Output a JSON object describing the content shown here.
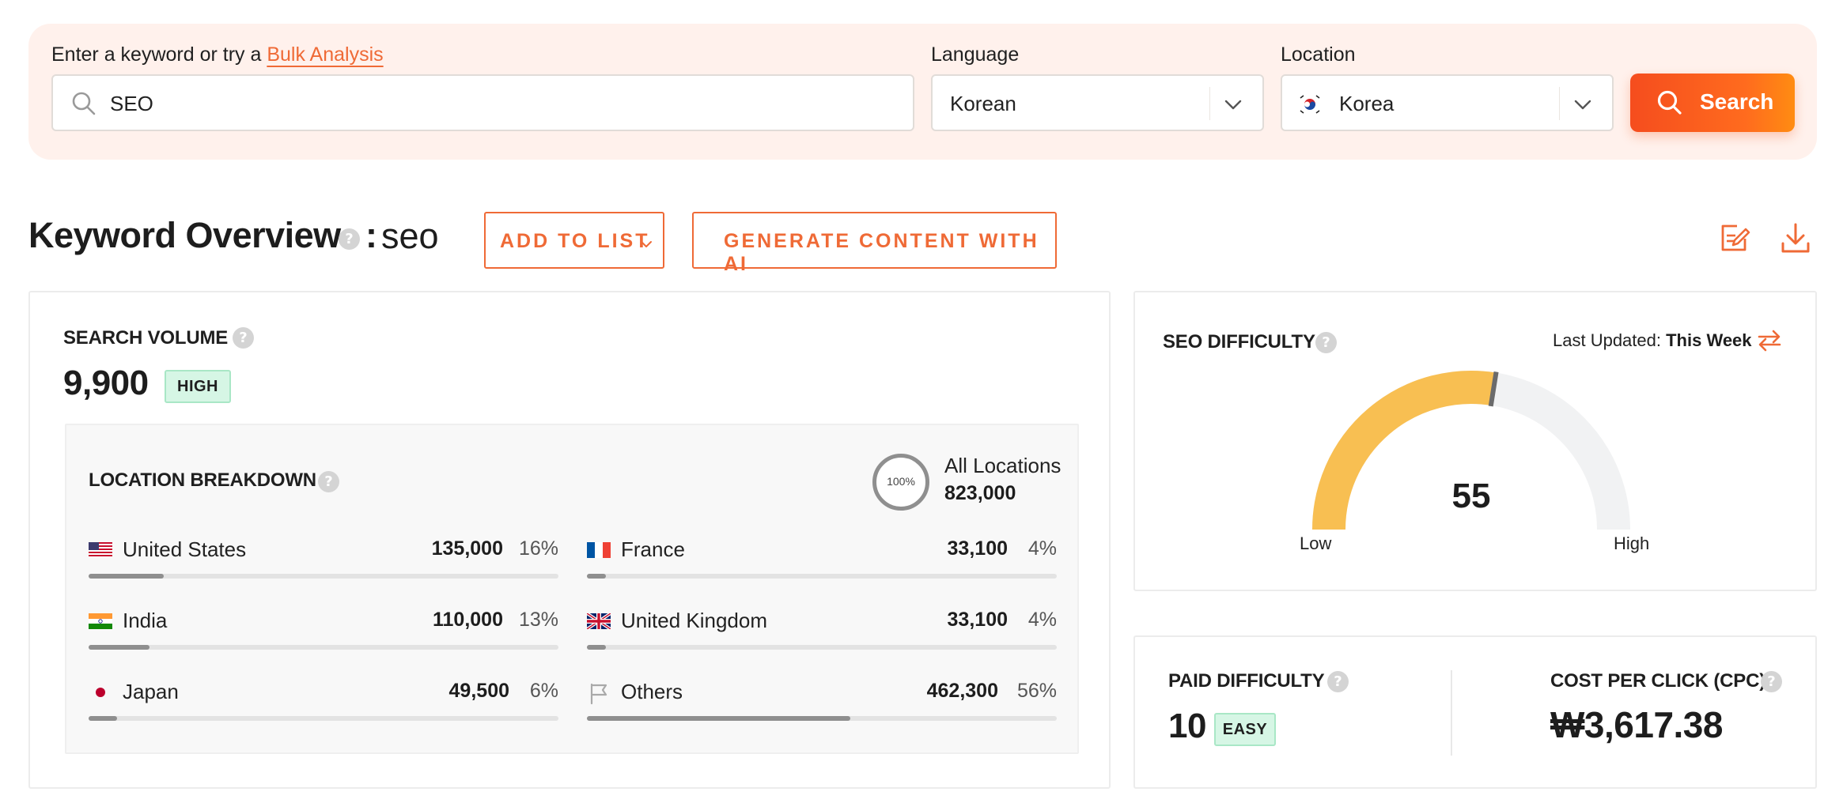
{
  "search": {
    "prompt_text": "Enter a keyword or try a",
    "bulk_link": "Bulk Analysis",
    "keyword_value": "SEO",
    "language_label": "Language",
    "language_value": "Korean",
    "location_label": "Location",
    "location_value": "Korea",
    "search_button": "Search"
  },
  "header": {
    "title": "Keyword Overview",
    "colon": ":",
    "keyword": "seo",
    "add_to_list": "ADD TO LIST",
    "generate_ai": "GENERATE CONTENT WITH AI",
    "icons": [
      "notes-edit-icon",
      "download-icon"
    ]
  },
  "search_volume": {
    "title": "SEARCH VOLUME",
    "value": "9,900",
    "badge": "HIGH"
  },
  "location_breakdown": {
    "title": "LOCATION BREAKDOWN",
    "ring_label": "100%",
    "all_label": "All Locations",
    "all_value": "823,000",
    "rows": [
      {
        "name": "United States",
        "value": "135,000",
        "pct": "16%",
        "share": 0.16,
        "flag": "us-flag-icon"
      },
      {
        "name": "France",
        "value": "33,100",
        "pct": "4%",
        "share": 0.04,
        "flag": "france-flag-icon"
      },
      {
        "name": "India",
        "value": "110,000",
        "pct": "13%",
        "share": 0.13,
        "flag": "india-flag-icon"
      },
      {
        "name": "United Kingdom",
        "value": "33,100",
        "pct": "4%",
        "share": 0.04,
        "flag": "uk-flag-icon"
      },
      {
        "name": "Japan",
        "value": "49,500",
        "pct": "6%",
        "share": 0.06,
        "flag": "japan-flag-icon"
      },
      {
        "name": "Others",
        "value": "462,300",
        "pct": "56%",
        "share": 0.56,
        "flag": "outline-flag-icon"
      }
    ]
  },
  "seo_difficulty": {
    "title": "SEO DIFFICULTY",
    "last_updated_label": "Last Updated:",
    "last_updated_value": "This Week",
    "value": "55",
    "score": 55,
    "low_label": "Low",
    "high_label": "High",
    "fill_color": "#f8bf52",
    "track_color": "#f1f2f3"
  },
  "paid_difficulty": {
    "title": "PAID DIFFICULTY",
    "value": "10",
    "badge": "EASY"
  },
  "cpc": {
    "title": "COST PER CLICK (CPC)",
    "value": "₩3,617.38"
  },
  "colors": {
    "accent": "#ef6a36",
    "panel_bg": "#fff1ec",
    "badge_bg": "#d6f6e5"
  }
}
